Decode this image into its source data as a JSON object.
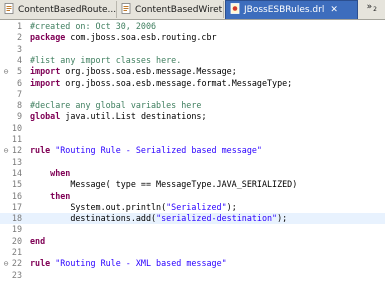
{
  "tabs": [
    {
      "label": "ContentBasedRoute...",
      "active": false,
      "icon": "java-file-icon"
    },
    {
      "label": "ContentBasedWiret...",
      "active": false,
      "icon": "java-file-icon"
    },
    {
      "label": "JBossESBRules.drl",
      "active": true,
      "icon": "drl-file-icon",
      "close": "✕"
    }
  ],
  "overflow": {
    "glyph": "»",
    "count": "2"
  },
  "colors": {
    "keyword": "#7f0055",
    "string": "#2a00ff",
    "comment": "#3f7f5f",
    "active_tab": "#3d6dbd",
    "current_line": "#e8f2fe"
  },
  "editor": {
    "current_line": 18,
    "lines": [
      {
        "n": "1",
        "fold": "",
        "tokens": [
          [
            "cm",
            "#created on: Oct 30, 2006"
          ]
        ]
      },
      {
        "n": "2",
        "fold": "",
        "tokens": [
          [
            "kw",
            "package"
          ],
          [
            "plain",
            " com.jboss.soa.esb.routing.cbr"
          ]
        ]
      },
      {
        "n": "3",
        "fold": "",
        "tokens": []
      },
      {
        "n": "4",
        "fold": "",
        "tokens": [
          [
            "cm",
            "#list any import classes here."
          ]
        ]
      },
      {
        "n": "5",
        "fold": "⊖",
        "tokens": [
          [
            "kw",
            "import"
          ],
          [
            "plain",
            " org.jboss.soa.esb.message.Message;"
          ]
        ]
      },
      {
        "n": "6",
        "fold": "",
        "tokens": [
          [
            "kw",
            "import"
          ],
          [
            "plain",
            " org.jboss.soa.esb.message.format.MessageType;"
          ]
        ]
      },
      {
        "n": "7",
        "fold": "",
        "tokens": []
      },
      {
        "n": "8",
        "fold": "",
        "tokens": [
          [
            "cm",
            "#declare any global variables here"
          ]
        ]
      },
      {
        "n": "9",
        "fold": "",
        "tokens": [
          [
            "kw",
            "global"
          ],
          [
            "plain",
            " java.util.List destinations;"
          ]
        ]
      },
      {
        "n": "10",
        "fold": "",
        "tokens": []
      },
      {
        "n": "11",
        "fold": "",
        "tokens": []
      },
      {
        "n": "12",
        "fold": "⊖",
        "tokens": [
          [
            "kw",
            "rule"
          ],
          [
            "plain",
            " "
          ],
          [
            "str",
            "\"Routing Rule - Serialized based message\""
          ]
        ]
      },
      {
        "n": "13",
        "fold": "",
        "tokens": []
      },
      {
        "n": "14",
        "fold": "",
        "tokens": [
          [
            "plain",
            "    "
          ],
          [
            "kw",
            "when"
          ]
        ]
      },
      {
        "n": "15",
        "fold": "",
        "tokens": [
          [
            "plain",
            "        Message( type == MessageType.JAVA_SERIALIZED)"
          ]
        ]
      },
      {
        "n": "16",
        "fold": "",
        "tokens": [
          [
            "plain",
            "    "
          ],
          [
            "kw",
            "then"
          ]
        ]
      },
      {
        "n": "17",
        "fold": "",
        "tokens": [
          [
            "plain",
            "        System.out.println("
          ],
          [
            "str",
            "\"Serialized\""
          ],
          [
            "plain",
            ");"
          ]
        ]
      },
      {
        "n": "18",
        "fold": "",
        "tokens": [
          [
            "plain",
            "        destinations.add("
          ],
          [
            "str",
            "\"serialized-destination\""
          ],
          [
            "plain",
            ");"
          ]
        ]
      },
      {
        "n": "19",
        "fold": "",
        "tokens": []
      },
      {
        "n": "20",
        "fold": "",
        "tokens": [
          [
            "kw",
            "end"
          ]
        ]
      },
      {
        "n": "21",
        "fold": "",
        "tokens": []
      },
      {
        "n": "22",
        "fold": "⊖",
        "tokens": [
          [
            "kw",
            "rule"
          ],
          [
            "plain",
            " "
          ],
          [
            "str",
            "\"Routing Rule - XML based message\""
          ]
        ]
      },
      {
        "n": "23",
        "fold": "",
        "tokens": []
      }
    ]
  }
}
